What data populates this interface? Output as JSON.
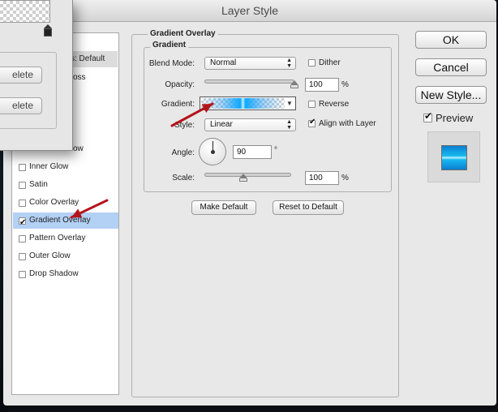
{
  "window": {
    "title": "Layer Style"
  },
  "styles_panel": {
    "header": "s: Default",
    "partial_items": [
      "oss",
      "ow"
    ],
    "items": [
      {
        "label": "Inner Glow",
        "checked": false,
        "selected": false
      },
      {
        "label": "Satin",
        "checked": false,
        "selected": false
      },
      {
        "label": "Color Overlay",
        "checked": false,
        "selected": false
      },
      {
        "label": "Gradient Overlay",
        "checked": true,
        "selected": true
      },
      {
        "label": "Pattern Overlay",
        "checked": false,
        "selected": false
      },
      {
        "label": "Outer Glow",
        "checked": false,
        "selected": false
      },
      {
        "label": "Drop Shadow",
        "checked": false,
        "selected": false
      }
    ]
  },
  "gradient_editor": {
    "delete_1": "elete",
    "delete_2": "elete"
  },
  "gradient_overlay": {
    "section_title": "Gradient Overlay",
    "subsection_title": "Gradient",
    "blend_mode": {
      "label": "Blend Mode:",
      "value": "Normal"
    },
    "dither": {
      "label": "Dither",
      "checked": false
    },
    "opacity": {
      "label": "Opacity:",
      "value": "100",
      "unit": "%",
      "level": 1.0
    },
    "gradient": {
      "label": "Gradient:"
    },
    "reverse": {
      "label": "Reverse",
      "checked": false
    },
    "style": {
      "label": "Style:",
      "value": "Linear"
    },
    "align_with_layer": {
      "label": "Align with Layer",
      "checked": true
    },
    "angle": {
      "label": "Angle:",
      "value": "90",
      "unit": "°"
    },
    "scale": {
      "label": "Scale:",
      "value": "100",
      "unit": "%",
      "level": 0.45
    },
    "make_default": "Make Default",
    "reset_to_default": "Reset to Default"
  },
  "actions": {
    "ok": "OK",
    "cancel": "Cancel",
    "new_style": "New Style...",
    "preview": {
      "label": "Preview",
      "checked": true
    }
  },
  "colors": {
    "annotation_arrow": "#b3141b",
    "selection": "#b3d0f5",
    "gradient_blue": "#0fa8ff"
  }
}
